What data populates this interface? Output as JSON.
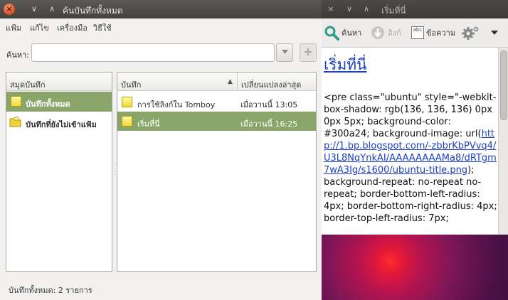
{
  "search_window": {
    "title": "ค้นบันทึกทั้งหมด",
    "title_controls": {
      "close": "×",
      "minimize": "∨",
      "maximize": "∧"
    },
    "menu": [
      "แฟ้ม",
      "แก้ไข",
      "เครื่องมือ",
      "วิธีใช้"
    ],
    "search": {
      "label": "ค้นหา:",
      "value": "",
      "placeholder": ""
    },
    "notebooks": {
      "header": "สมุดบันทึก",
      "items": [
        {
          "label": "บันทึกทั้งหมด",
          "selected": true,
          "icon": "note-icon"
        },
        {
          "label": "บันทึกที่ยังไม่เข้าแฟ้ม",
          "selected": false,
          "icon": "folder-icon"
        }
      ]
    },
    "notes": {
      "columns": {
        "name": "บันทึก",
        "sort_indicator": "▲",
        "modified": "เปลี่ยนแปลงล่าสุด"
      },
      "rows": [
        {
          "name": "การใช้ลิงก์ใน Tomboy",
          "modified": "เมื่อวานนี้ 13:05",
          "selected": false
        },
        {
          "name": "เริ่มที่นี่",
          "modified": "เมื่อวานนี้ 16:25",
          "selected": true
        }
      ]
    },
    "status": "บันทึกทั้งหมด: 2 รายการ"
  },
  "note_window": {
    "title": "เริ่มที่นี่",
    "title_controls": {
      "close": "×",
      "minimize": "∨",
      "maximize": "∧"
    },
    "toolbar": {
      "search": "ค้นหา",
      "link": "ลิงก์",
      "text": "ข้อความ",
      "text_icon_glyph": "abc"
    },
    "note": {
      "heading": "เริ่มที่นี่",
      "body_before": "<pre class=\"ubuntu\" style=\"-webkit-box-shadow: rgb(136, 136, 136) 0px 0px 5px; background-color: #300a24; background-image: url(",
      "body_link": "http://1.bp.blogspot.com/-zbbrKbPVvq4/U3L8NqYnkAI/AAAAAAAAMa8/dRTgm7wA3Ig/s1600/ubuntu-title.png",
      "body_after": "); background-repeat: no-repeat no-repeat; border-bottom-left-radius: 4px; border-bottom-right-radius: 4px; border-top-left-radius: 7px;"
    }
  },
  "colors": {
    "selection": "#8aa56a",
    "link": "#1a3fc6",
    "titlebar": "#43423e",
    "close_button": "#e2572b"
  }
}
